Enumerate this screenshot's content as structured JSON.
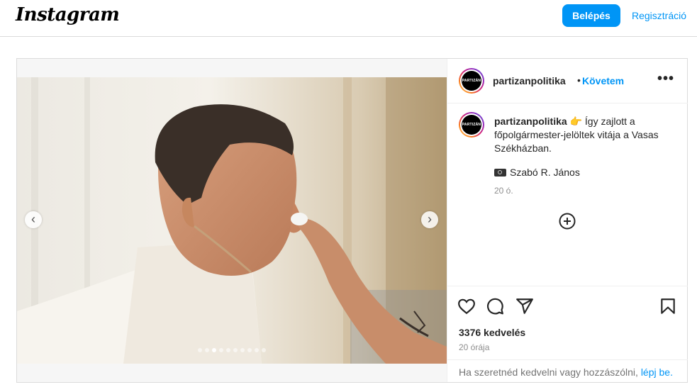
{
  "topbar": {
    "logo": "Instagram",
    "login_button": "Belépés",
    "signup_link": "Regisztráció"
  },
  "post": {
    "username": "partizanpolitika",
    "separator": "•",
    "follow": "Követem",
    "avatar_text": "PARTIZÁN",
    "caption_user": "partizanpolitika",
    "caption_emoji": "👉",
    "caption_text": "Így zajlott a főpolgármester-jelöltek vitája a Vasas Székházban.",
    "photo_credit": "Szabó R. János",
    "caption_time": "20 ó.",
    "likes": "3376 kedvelés",
    "posted_ago": "20 órája",
    "login_prompt": "Ha szeretnéd kedvelni vagy hozzászólni,",
    "login_link": "lépj be."
  },
  "carousel": {
    "slide_count": 10,
    "active_index": 2
  },
  "icons": [
    "chevron-left-icon",
    "chevron-right-icon",
    "more-options-icon",
    "camera-icon",
    "add-comment-icon",
    "heart-icon",
    "comment-icon",
    "share-icon",
    "bookmark-icon"
  ],
  "colors": {
    "brand_blue": "#0095f6",
    "border": "#dbdbdb",
    "muted_text": "#8e8e8e"
  }
}
